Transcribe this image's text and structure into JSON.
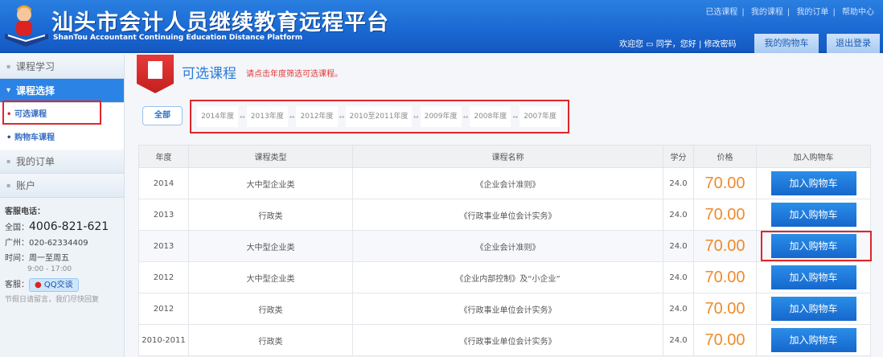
{
  "header": {
    "title": "汕头市会计人员继续教育远程平台",
    "subtitle": "ShanTou Accountant Continuing Education Distance Platform",
    "links": [
      "已选课程",
      "我的课程",
      "我的订单",
      "帮助中心"
    ],
    "welcome": "欢迎您 ▭ 同学，您好 | 修改密码",
    "cart_button": "我的购物车",
    "logout_button": "退出登录"
  },
  "sidebar": {
    "items": [
      "课程学习",
      "课程选择",
      "我的订单",
      "账户"
    ],
    "subitems": [
      "可选课程",
      "购物车课程"
    ],
    "contact": {
      "title": "客服电话：",
      "national_label": "全国：",
      "national": "4006-821-621",
      "gz_label": "广州：",
      "gz": "020-62334409",
      "hours_label": "时间：",
      "days": "周一至周五",
      "hours": "9:00 - 17:00",
      "online_label": "客服：",
      "qq": "QQ交谈",
      "note": "节假日请留言，我们尽快回复"
    }
  },
  "main": {
    "title": "可选课程",
    "note": "请点击年度筛选可选课程。",
    "all_button": "全部",
    "filters": [
      "2014年度",
      "2013年度",
      "2012年度",
      "2010至2011年度",
      "2009年度",
      "2008年度",
      "2007年度"
    ],
    "columns": [
      "年度",
      "课程类型",
      "课程名称",
      "学分",
      "价格",
      "加入购物车"
    ],
    "rows": [
      {
        "year": "2014",
        "type": "大中型企业类",
        "name": "《企业会计准则》",
        "credit": "24.0",
        "price": "70.00",
        "action": "加入购物车"
      },
      {
        "year": "2013",
        "type": "行政类",
        "name": "《行政事业单位会计实务》",
        "credit": "24.0",
        "price": "70.00",
        "action": "加入购物车"
      },
      {
        "year": "2013",
        "type": "大中型企业类",
        "name": "《企业会计准则》",
        "credit": "24.0",
        "price": "70.00",
        "action": "加入购物车"
      },
      {
        "year": "2012",
        "type": "大中型企业类",
        "name": "《企业内部控制》及“小企业”",
        "credit": "24.0",
        "price": "70.00",
        "action": "加入购物车"
      },
      {
        "year": "2012",
        "type": "行政类",
        "name": "《行政事业单位会计实务》",
        "credit": "24.0",
        "price": "70.00",
        "action": "加入购物车"
      },
      {
        "year": "2010-2011",
        "type": "行政类",
        "name": "《行政事业单位会计实务》",
        "credit": "24.0",
        "price": "70.00",
        "action": "加入购物车"
      }
    ]
  }
}
